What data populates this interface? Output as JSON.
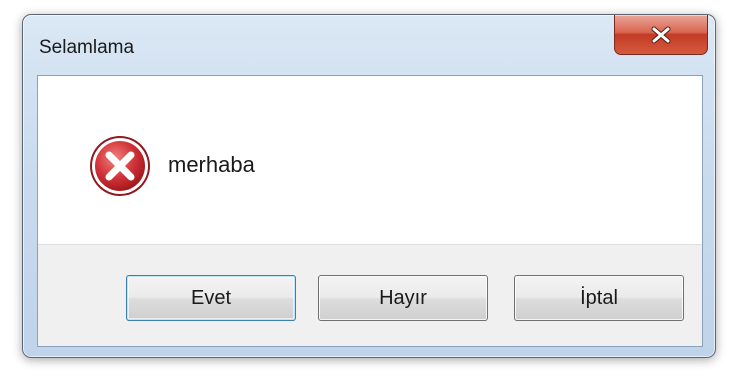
{
  "window": {
    "title": "Selamlama"
  },
  "icons": {
    "close": "close-icon",
    "status": "error-icon"
  },
  "message": {
    "text": "merhaba"
  },
  "buttons": [
    {
      "label": "Evet",
      "default": true
    },
    {
      "label": "Hayır",
      "default": false
    },
    {
      "label": "İptal",
      "default": false
    }
  ],
  "colors": {
    "close_button": "#c33b24",
    "error_icon": "#c8242b",
    "default_button_border": "#3c7fb1",
    "footer_background": "#f0f0f0"
  }
}
